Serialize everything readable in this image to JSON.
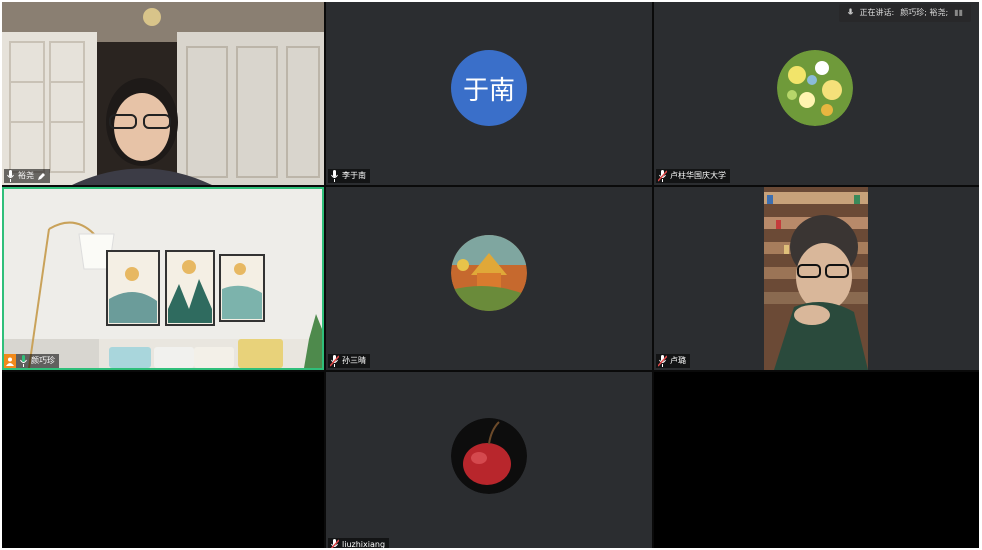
{
  "speaking_bar": {
    "prefix": "正在讲话:",
    "names": "颜巧珍; 裕尧;"
  },
  "participants": [
    {
      "name": "裕尧",
      "icon": "mic-icon",
      "has_edit_icon": true,
      "video": "on"
    },
    {
      "name": "李于南",
      "icon": "mic-icon",
      "avatar_text": "于南",
      "avatar_color": "#3a6fc9"
    },
    {
      "name": "卢柱华国庆大学",
      "icon": "muted-mic-icon",
      "avatar": "flowers"
    },
    {
      "name": "颜巧珍",
      "icon": "mic-active-icon",
      "host_badge": true,
      "video": "on",
      "active_speaker": true
    },
    {
      "name": "孙三晴",
      "icon": "muted-mic-icon",
      "avatar": "painting"
    },
    {
      "name": "卢璐",
      "icon": "muted-mic-icon",
      "video": "on"
    },
    {
      "name": "liuzhixiang",
      "icon": "muted-mic-icon",
      "avatar": "apple"
    }
  ]
}
